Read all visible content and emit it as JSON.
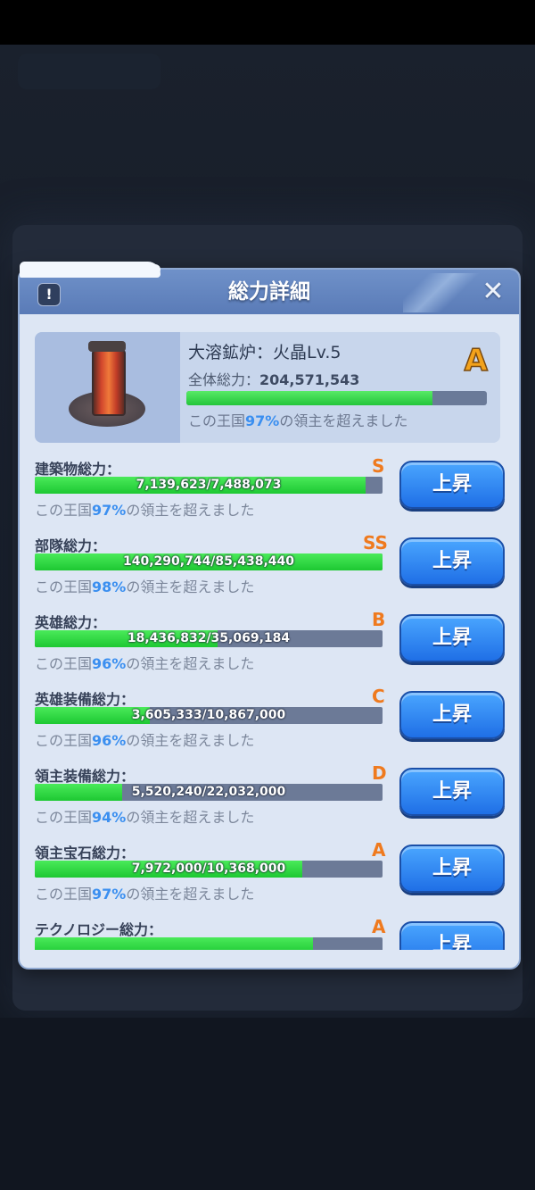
{
  "dialog": {
    "title": "総力詳細",
    "info_label": "!",
    "close_label": "✕"
  },
  "summary": {
    "name": "大溶鉱炉：火晶Lv.5",
    "total_label": "全体総力：",
    "total_value": "204,571,543",
    "grade": "A",
    "progress": 0.82,
    "pct_prefix": "この王国",
    "pct_value": "97%",
    "pct_suffix": "の領主を超えました"
  },
  "rows": [
    {
      "label": "建築物総力：",
      "grade": "S",
      "value": "7,139,623/7,488,073",
      "fill": 0.95,
      "pct_prefix": "この王国",
      "pct": "97%",
      "pct_suffix": "の領主を超えました",
      "button": "上昇"
    },
    {
      "label": "部隊総力：",
      "grade": "SS",
      "value": "140,290,744/85,438,440",
      "fill": 1.0,
      "pct_prefix": "この王国",
      "pct": "98%",
      "pct_suffix": "の領主を超えました",
      "button": "上昇"
    },
    {
      "label": "英雄総力：",
      "grade": "B",
      "value": "18,436,832/35,069,184",
      "fill": 0.526,
      "pct_prefix": "この王国",
      "pct": "96%",
      "pct_suffix": "の領主を超えました",
      "button": "上昇"
    },
    {
      "label": "英雄装備総力：",
      "grade": "C",
      "value": "3,605,333/10,867,000",
      "fill": 0.33,
      "pct_prefix": "この王国",
      "pct": "96%",
      "pct_suffix": "の領主を超えました",
      "button": "上昇"
    },
    {
      "label": "領主装備総力：",
      "grade": "D",
      "value": "5,520,240/22,032,000",
      "fill": 0.25,
      "pct_prefix": "この王国",
      "pct": "94%",
      "pct_suffix": "の領主を超えました",
      "button": "上昇"
    },
    {
      "label": "領主宝石総力：",
      "grade": "A",
      "value": "7,972,000/10,368,000",
      "fill": 0.77,
      "pct_prefix": "この王国",
      "pct": "97%",
      "pct_suffix": "の領主を超えました",
      "button": "上昇"
    },
    {
      "label": "テクノロジー総力：",
      "grade": "A",
      "value": "",
      "fill": 0.8,
      "pct_prefix": "",
      "pct": "",
      "pct_suffix": "",
      "button": "上昇"
    }
  ]
}
